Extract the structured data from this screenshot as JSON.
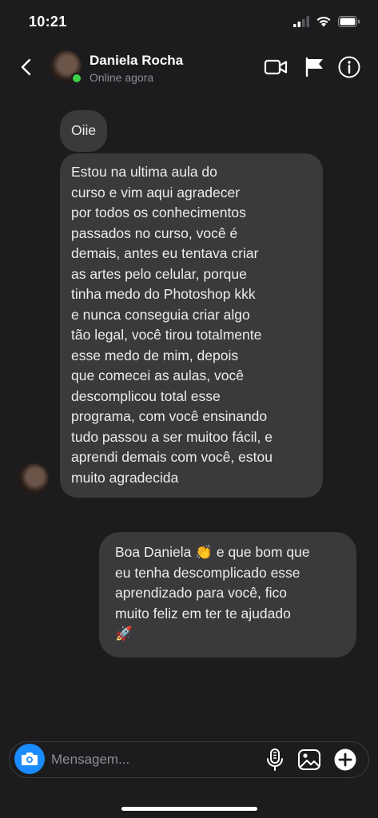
{
  "status_bar": {
    "time": "10:21"
  },
  "header": {
    "contact_name": "Daniela Rocha",
    "contact_status": "Online agora"
  },
  "messages": [
    {
      "sender": "contact",
      "text": "Oiie"
    },
    {
      "sender": "contact",
      "text": "Estou na ultima aula do\ncurso e vim aqui agradecer\npor todos os conhecimentos\npassados no curso, você é\ndemais, antes eu tentava criar\nas artes pelo celular, porque\ntinha medo do Photoshop kkk\ne nunca conseguia criar algo\ntão legal, você tirou totalmente\nesse medo de mim, depois\nque comecei as aulas, você\ndescomplicou total esse\nprograma, com você ensinando\ntudo passou a ser muitoo fácil, e\naprendi demais com você, estou\nmuito agradecida"
    },
    {
      "sender": "me",
      "text": "Boa Daniela 👏 e que bom que\neu tenha descomplicado esse\naprendizado para você, fico\nmuito feliz em ter te ajudado\n🚀"
    }
  ],
  "composer": {
    "placeholder": "Mensagem..."
  },
  "colors": {
    "background": "#1c1c1e",
    "bubble": "#3a3a3c",
    "online": "#3ed147",
    "camera_button": "#1a8cff"
  },
  "icons": {
    "back": "chevron-left-icon",
    "video": "video-camera-icon",
    "flag": "flag-icon",
    "info": "info-icon",
    "camera": "camera-icon",
    "microphone": "microphone-icon",
    "gallery": "image-icon",
    "add": "plus-circle-icon"
  }
}
